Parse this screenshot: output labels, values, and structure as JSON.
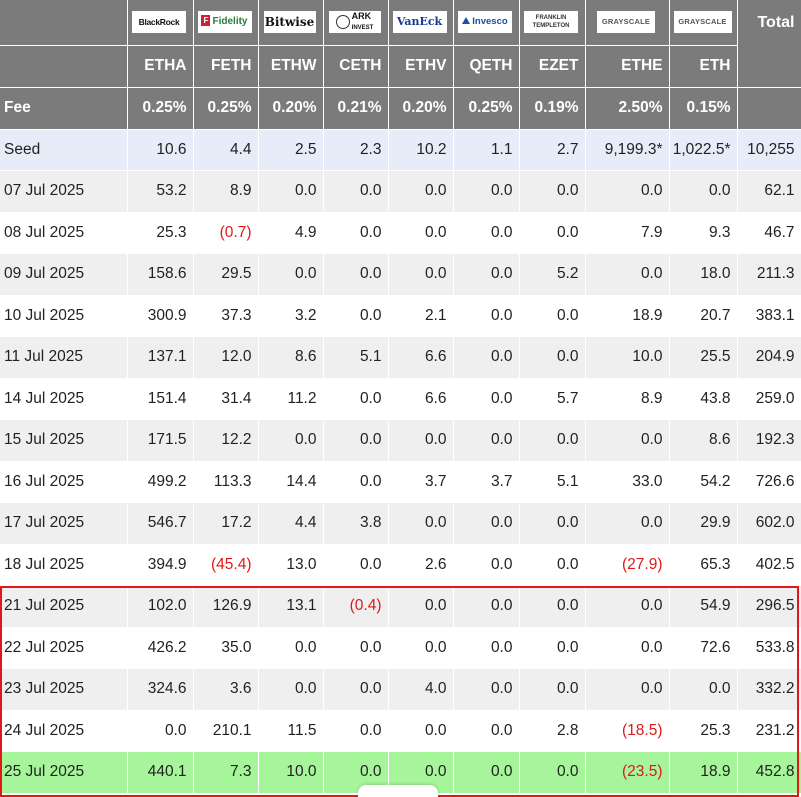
{
  "header": {
    "total_label": "Total",
    "fee_label": "Fee",
    "funds": [
      {
        "issuer": "BlackRock",
        "ticker": "ETHA",
        "fee": "0.25%"
      },
      {
        "issuer": "Fidelity",
        "ticker": "FETH",
        "fee": "0.25%"
      },
      {
        "issuer": "Bitwise",
        "ticker": "ETHW",
        "fee": "0.20%"
      },
      {
        "issuer": "ARK",
        "issuer_sub": "INVEST",
        "ticker": "CETH",
        "fee": "0.21%"
      },
      {
        "issuer": "VanEck",
        "ticker": "ETHV",
        "fee": "0.20%"
      },
      {
        "issuer": "Invesco",
        "ticker": "QETH",
        "fee": "0.25%"
      },
      {
        "issuer": "FRANKLIN",
        "issuer_sub": "TEMPLETON",
        "ticker": "EZET",
        "fee": "0.19%"
      },
      {
        "issuer": "GRAYSCALE",
        "ticker": "ETHE",
        "fee": "2.50%"
      },
      {
        "issuer": "GRAYSCALE",
        "ticker": "ETH",
        "fee": "0.15%"
      }
    ]
  },
  "rows": [
    {
      "label": "Seed",
      "cells": [
        "10.6",
        "4.4",
        "2.5",
        "2.3",
        "10.2",
        "1.1",
        "2.7",
        "9,199.3*",
        "1,022.5*",
        "10,255"
      ]
    },
    {
      "label": "07 Jul 2025",
      "cells": [
        "53.2",
        "8.9",
        "0.0",
        "0.0",
        "0.0",
        "0.0",
        "0.0",
        "0.0",
        "0.0",
        "62.1"
      ]
    },
    {
      "label": "08 Jul 2025",
      "cells": [
        "25.3",
        "(0.7)",
        "4.9",
        "0.0",
        "0.0",
        "0.0",
        "0.0",
        "7.9",
        "9.3",
        "46.7"
      ]
    },
    {
      "label": "09 Jul 2025",
      "cells": [
        "158.6",
        "29.5",
        "0.0",
        "0.0",
        "0.0",
        "0.0",
        "5.2",
        "0.0",
        "18.0",
        "211.3"
      ]
    },
    {
      "label": "10 Jul 2025",
      "cells": [
        "300.9",
        "37.3",
        "3.2",
        "0.0",
        "2.1",
        "0.0",
        "0.0",
        "18.9",
        "20.7",
        "383.1"
      ]
    },
    {
      "label": "11 Jul 2025",
      "cells": [
        "137.1",
        "12.0",
        "8.6",
        "5.1",
        "6.6",
        "0.0",
        "0.0",
        "10.0",
        "25.5",
        "204.9"
      ]
    },
    {
      "label": "14 Jul 2025",
      "cells": [
        "151.4",
        "31.4",
        "11.2",
        "0.0",
        "6.6",
        "0.0",
        "5.7",
        "8.9",
        "43.8",
        "259.0"
      ]
    },
    {
      "label": "15 Jul 2025",
      "cells": [
        "171.5",
        "12.2",
        "0.0",
        "0.0",
        "0.0",
        "0.0",
        "0.0",
        "0.0",
        "8.6",
        "192.3"
      ]
    },
    {
      "label": "16 Jul 2025",
      "cells": [
        "499.2",
        "113.3",
        "14.4",
        "0.0",
        "3.7",
        "3.7",
        "5.1",
        "33.0",
        "54.2",
        "726.6"
      ]
    },
    {
      "label": "17 Jul 2025",
      "cells": [
        "546.7",
        "17.2",
        "4.4",
        "3.8",
        "0.0",
        "0.0",
        "0.0",
        "0.0",
        "29.9",
        "602.0"
      ]
    },
    {
      "label": "18 Jul 2025",
      "cells": [
        "394.9",
        "(45.4)",
        "13.0",
        "0.0",
        "2.6",
        "0.0",
        "0.0",
        "(27.9)",
        "65.3",
        "402.5"
      ]
    },
    {
      "label": "21 Jul 2025",
      "cells": [
        "102.0",
        "126.9",
        "13.1",
        "(0.4)",
        "0.0",
        "0.0",
        "0.0",
        "0.0",
        "54.9",
        "296.5"
      ]
    },
    {
      "label": "22 Jul 2025",
      "cells": [
        "426.2",
        "35.0",
        "0.0",
        "0.0",
        "0.0",
        "0.0",
        "0.0",
        "0.0",
        "72.6",
        "533.8"
      ]
    },
    {
      "label": "23 Jul 2025",
      "cells": [
        "324.6",
        "3.6",
        "0.0",
        "0.0",
        "4.0",
        "0.0",
        "0.0",
        "0.0",
        "0.0",
        "332.2"
      ]
    },
    {
      "label": "24 Jul 2025",
      "cells": [
        "0.0",
        "210.1",
        "11.5",
        "0.0",
        "0.0",
        "0.0",
        "2.8",
        "(18.5)",
        "25.3",
        "231.2"
      ]
    },
    {
      "label": "25 Jul 2025",
      "cells": [
        "440.1",
        "7.3",
        "10.0",
        "0.0",
        "0.0",
        "0.0",
        "0.0",
        "(23.5)",
        "18.9",
        "452.8"
      ]
    }
  ],
  "styles": {
    "header_bg": "#7b7b7b",
    "negative_color": "#e01818",
    "highlight_row_bg": "#a6f59a",
    "seed_row_bg": "#e6ecf8",
    "selection_box_color": "#e01818"
  }
}
